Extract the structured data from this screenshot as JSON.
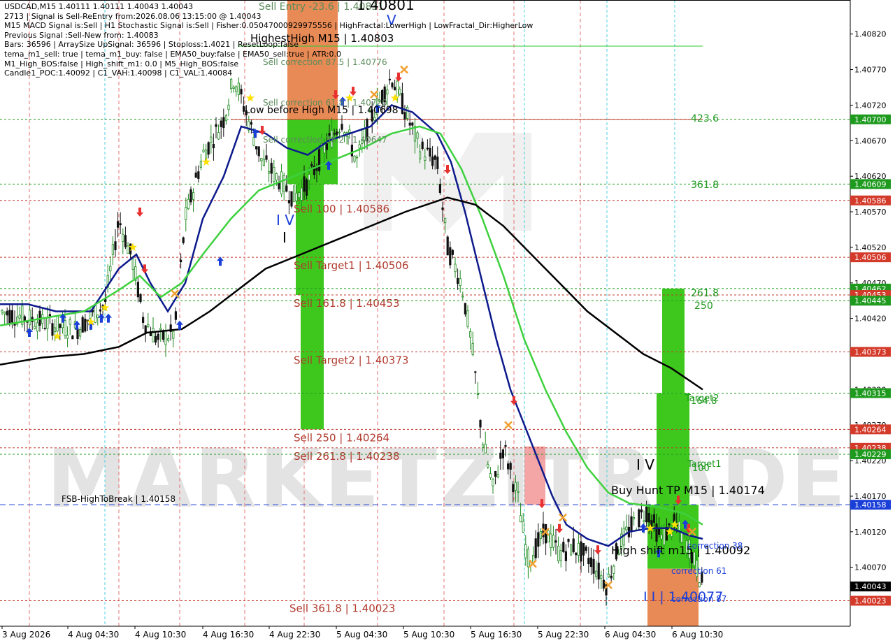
{
  "chart_data": {
    "type": "candlestick",
    "symbol_line": "USDCAD,M15  1.40111 1.40111 1.40043 1.40043",
    "info_lines": [
      "2713 | Signal is Sell-ReEntry from:2026.08.06 13:15:00 @ 1.40043",
      "M15 MACD Signal is:Sell | H1 Stochastic Signal is:Sell | Fisher:0.05047000929975556 | HighFractal:LowerHigh | LowFractal_Dir:HigherLow",
      "Previous Signal :Sell-New from: 1.40083",
      "Bars: 36596 | ArraySize UpSignal: 36596 | Stoploss:1.4021 | ResetLoop:false",
      "tema_m1_sell: true | tema_m1_buy: false | EMA50_buy:false | EMA50_sell:true | ATR:0.0",
      "M1_High_BOS:false | High_shift_m1: 0.0 | M5_High_BOS:false",
      "Candle1_POC:1.40092 | C1_VAH:1.40098 | C1_VAL:1.40084"
    ],
    "ylim": [
      1.39995,
      1.4086
    ],
    "y_ticks": [
      1.4082,
      1.4077,
      1.4072,
      1.4067,
      1.4062,
      1.4057,
      1.4052,
      1.4047,
      1.4042,
      1.4037,
      1.4032,
      1.4027,
      1.4022,
      1.4017,
      1.4012,
      1.4007,
      1.4002
    ],
    "x_labels": [
      "3 Aug 2026",
      "4 Aug 04:30",
      "4 Aug 10:30",
      "4 Aug 16:30",
      "4 Aug 22:30",
      "5 Aug 04:30",
      "5 Aug 10:30",
      "5 Aug 16:30",
      "5 Aug 22:30",
      "6 Aug 04:30",
      "6 Aug 10:30"
    ],
    "price_tags": [
      {
        "value": 1.407,
        "text": "1.40700",
        "color": "#1e9a1e"
      },
      {
        "value": 1.40609,
        "text": "1.40609",
        "color": "#1e9a1e"
      },
      {
        "value": 1.40586,
        "text": "1.40586",
        "color": "#d43a2a"
      },
      {
        "value": 1.40506,
        "text": "1.40506",
        "color": "#d43a2a"
      },
      {
        "value": 1.40462,
        "text": "1.40462",
        "color": "#1e9a1e"
      },
      {
        "value": 1.40453,
        "text": "1.40453",
        "color": "#d43a2a"
      },
      {
        "value": 1.40445,
        "text": "1.40445",
        "color": "#1e9a1e"
      },
      {
        "value": 1.40373,
        "text": "1.40373",
        "color": "#d43a2a"
      },
      {
        "value": 1.40315,
        "text": "1.40315",
        "color": "#1e9a1e"
      },
      {
        "value": 1.40264,
        "text": "1.40264",
        "color": "#d43a2a"
      },
      {
        "value": 1.40238,
        "text": "1.40238",
        "color": "#d43a2a"
      },
      {
        "value": 1.40229,
        "text": "1.40229",
        "color": "#1e9a1e"
      },
      {
        "value": 1.40158,
        "text": "1.40158",
        "color": "#1a3fd8"
      },
      {
        "value": 1.40043,
        "text": "1.40043",
        "color": "#000000"
      },
      {
        "value": 1.40023,
        "text": "1.40023",
        "color": "#d43a2a"
      }
    ],
    "levels": [
      {
        "value": 1.40803,
        "text": "HighestHigh   M15 | 1.40803",
        "color": "#2ec82e",
        "style": "solid"
      },
      {
        "value": 1.407,
        "text": "",
        "color": "#1e9a1e",
        "style": "dotted"
      },
      {
        "value": 1.40609,
        "text": "",
        "color": "#1e9a1e",
        "style": "dotted"
      },
      {
        "value": 1.40586,
        "text": "Sell 100 | 1.40586",
        "color": "#c0392b",
        "style": "dotted"
      },
      {
        "value": 1.40506,
        "text": "Sell Target1 | 1.40506",
        "color": "#c0392b",
        "style": "dotted"
      },
      {
        "value": 1.40462,
        "text": "",
        "color": "#1e9a1e",
        "style": "dotted"
      },
      {
        "value": 1.40453,
        "text": "Sell 161.8 | 1.40453",
        "color": "#c0392b",
        "style": "dotted"
      },
      {
        "value": 1.40445,
        "text": "",
        "color": "#1e9a1e",
        "style": "dotted"
      },
      {
        "value": 1.40373,
        "text": "Sell Target2 | 1.40373",
        "color": "#c0392b",
        "style": "dotted"
      },
      {
        "value": 1.40315,
        "text": "",
        "color": "#1e9a1e",
        "style": "dotted"
      },
      {
        "value": 1.40264,
        "text": "Sell  250 | 1.40264",
        "color": "#c0392b",
        "style": "dotted"
      },
      {
        "value": 1.40238,
        "text": "Sell  261.8 | 1.40238",
        "color": "#c0392b",
        "style": "dotted"
      },
      {
        "value": 1.40229,
        "text": "",
        "color": "#1e9a1e",
        "style": "dotted"
      },
      {
        "value": 1.40158,
        "text": "FSB-HighToBreak | 1.40158",
        "color": "#1a3fd8",
        "style": "dashed"
      },
      {
        "value": 1.40023,
        "text": "Sell  361.8 | 1.40023",
        "color": "#c0392b",
        "style": "dotted"
      }
    ],
    "annotations": [
      {
        "text": "Sell Entry -23.6 | 1.40831",
        "value": 1.40855,
        "color": "#5a8a5a"
      },
      {
        "text": "1.40801",
        "value": 1.40855,
        "color": "#000000"
      },
      {
        "text": "Sell correction 87.5 | 1.40776",
        "value": 1.40776,
        "color": "#5a8a5a"
      },
      {
        "text": "Sell correction 61.8 | 1.40720",
        "value": 1.4072,
        "color": "#5a8a5a"
      },
      {
        "text": "Low before High   M15 | 1.40698",
        "value": 1.40706,
        "color": "#000000"
      },
      {
        "text": "Sell correction 38.2 | 1.40647",
        "value": 1.40648,
        "color": "#5a8a5a"
      },
      {
        "text": "423.6",
        "value": 1.40695,
        "color": "#1e9a1e"
      },
      {
        "text": "361.8",
        "value": 1.40604,
        "color": "#1e9a1e"
      },
      {
        "text": "261.8",
        "value": 1.4045,
        "color": "#1e9a1e"
      },
      {
        "text": "250",
        "value": 1.40432,
        "color": "#1e9a1e"
      },
      {
        "text": "Target2",
        "value": 1.40315,
        "color": "#1e9a1e"
      },
      {
        "text": "164.8",
        "value": 1.40308,
        "color": "#1e9a1e"
      },
      {
        "text": "Target1",
        "value": 1.40215,
        "color": "#1e9a1e"
      },
      {
        "text": "100",
        "value": 1.40208,
        "color": "#1e9a1e"
      },
      {
        "text": "Buy Hunt TP M15 | 1.40174",
        "value": 1.4018,
        "color": "#000000"
      },
      {
        "text": "High shift m15 | 1.40092",
        "value": 1.40098,
        "color": "#000000"
      },
      {
        "text": "correction 38",
        "value": 1.40108,
        "color": "#1a3fd8"
      },
      {
        "text": "correction 61",
        "value": 1.40068,
        "color": "#1a3fd8"
      },
      {
        "text": "correction 87",
        "value": 1.4004,
        "color": "#1a3fd8"
      },
      {
        "text": "I I | 1.40077",
        "value": 1.40043,
        "color": "#1a3fd8"
      },
      {
        "text": "I V",
        "value": 1.40228,
        "color": "#000000"
      },
      {
        "text": "I V",
        "value": 1.4054,
        "color": "#1a3fd8"
      },
      {
        "text": "I",
        "value": 1.40514,
        "color": "#000000"
      },
      {
        "text": "V",
        "value": 1.40855,
        "color": "#1a3fd8"
      }
    ],
    "watermark": "MARKETZITRADE",
    "colors": {
      "bull": "#1e8a1e",
      "bear": "#111111",
      "ma_fast": "#0d1a8c",
      "ma_mid": "#3ed13e",
      "ma_slow": "#000000",
      "box_green": "#3ec81e",
      "box_orange": "#e88a55",
      "sell_red": "#e83030",
      "buy_blue": "#1a3fd8",
      "star": "#ffe000"
    }
  }
}
